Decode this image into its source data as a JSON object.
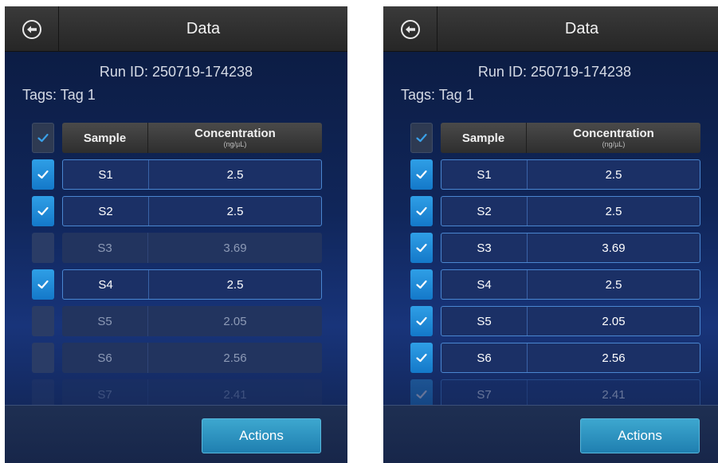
{
  "screens": [
    {
      "title": "Data",
      "run_id": "Run ID: 250719-174238",
      "tags": "Tags: Tag 1",
      "header": {
        "sample": "Sample",
        "concentration": "Concentration",
        "unit": "(ng/µL)"
      },
      "rows": [
        {
          "sample": "S1",
          "concentration": "2.5",
          "checked": true
        },
        {
          "sample": "S2",
          "concentration": "2.5",
          "checked": true
        },
        {
          "sample": "S3",
          "concentration": "3.69",
          "checked": false
        },
        {
          "sample": "S4",
          "concentration": "2.5",
          "checked": true
        },
        {
          "sample": "S5",
          "concentration": "2.05",
          "checked": false
        },
        {
          "sample": "S6",
          "concentration": "2.56",
          "checked": false
        },
        {
          "sample": "S7",
          "concentration": "2.41",
          "checked": false
        }
      ],
      "actions_label": "Actions"
    },
    {
      "title": "Data",
      "run_id": "Run ID: 250719-174238",
      "tags": "Tags: Tag 1",
      "header": {
        "sample": "Sample",
        "concentration": "Concentration",
        "unit": "(ng/µL)"
      },
      "rows": [
        {
          "sample": "S1",
          "concentration": "2.5",
          "checked": true
        },
        {
          "sample": "S2",
          "concentration": "2.5",
          "checked": true
        },
        {
          "sample": "S3",
          "concentration": "3.69",
          "checked": true
        },
        {
          "sample": "S4",
          "concentration": "2.5",
          "checked": true
        },
        {
          "sample": "S5",
          "concentration": "2.05",
          "checked": true
        },
        {
          "sample": "S6",
          "concentration": "2.56",
          "checked": true
        },
        {
          "sample": "S7",
          "concentration": "2.41",
          "checked": true
        }
      ],
      "actions_label": "Actions"
    }
  ],
  "colors": {
    "checkbox_checked": "#1f8ad6",
    "selected_row_border": "#4a86d0",
    "actions_button": "#2a93c2",
    "check_mark_header": "#3aa0e8"
  },
  "icons": {
    "back": "back-arrow-circle-icon",
    "check": "checkmark-icon"
  }
}
